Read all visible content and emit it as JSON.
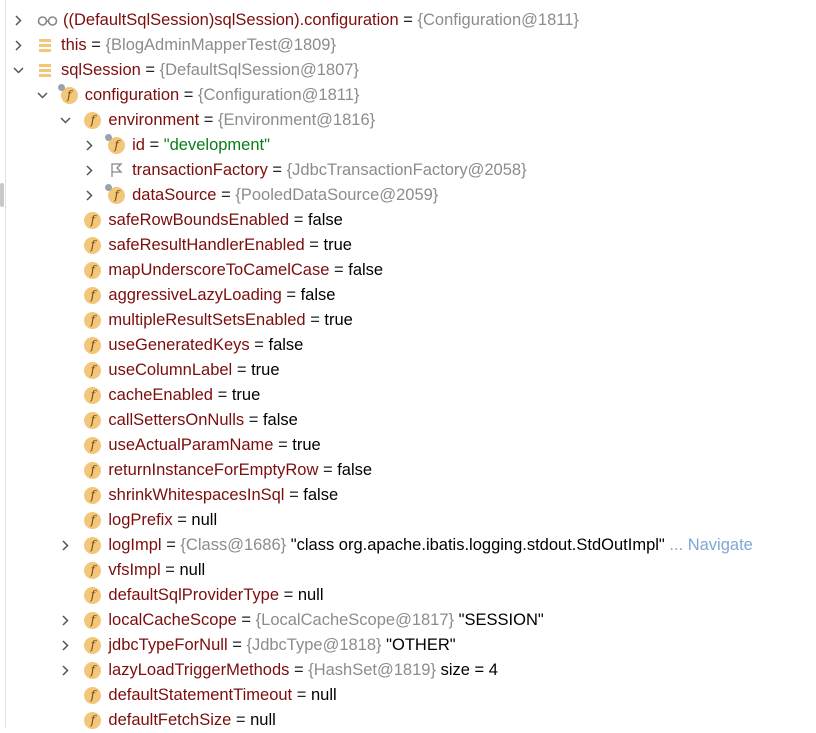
{
  "rows": [
    {
      "level": 0,
      "state": "collapsed",
      "icon": "watch-glasses-icon",
      "name": "((DefaultSqlSession)sqlSession).configuration",
      "type": "{Configuration@1811}"
    },
    {
      "level": 0,
      "state": "collapsed",
      "icon": "stack-frame-icon",
      "name": "this",
      "type": "{BlogAdminMapperTest@1809}"
    },
    {
      "level": 0,
      "state": "expanded",
      "icon": "stack-frame-icon",
      "name": "sqlSession",
      "type": "{DefaultSqlSession@1807}"
    },
    {
      "level": 1,
      "state": "expanded",
      "icon": "final-field-icon",
      "name": "configuration",
      "type": "{Configuration@1811}"
    },
    {
      "level": 2,
      "state": "expanded",
      "icon": "field-icon",
      "name": "environment",
      "type": "{Environment@1816}"
    },
    {
      "level": 3,
      "state": "collapsed",
      "icon": "final-field-icon",
      "name": "id",
      "string": "\"development\""
    },
    {
      "level": 3,
      "state": "collapsed",
      "icon": "flag-icon",
      "name": "transactionFactory",
      "type": "{JdbcTransactionFactory@2058}"
    },
    {
      "level": 3,
      "state": "collapsed",
      "icon": "final-field-icon",
      "name": "dataSource",
      "type": "{PooledDataSource@2059}"
    },
    {
      "level": 2,
      "state": "none",
      "icon": "field-icon",
      "name": "safeRowBoundsEnabled",
      "value": "false"
    },
    {
      "level": 2,
      "state": "none",
      "icon": "field-icon",
      "name": "safeResultHandlerEnabled",
      "value": "true"
    },
    {
      "level": 2,
      "state": "none",
      "icon": "field-icon",
      "name": "mapUnderscoreToCamelCase",
      "value": "false"
    },
    {
      "level": 2,
      "state": "none",
      "icon": "field-icon",
      "name": "aggressiveLazyLoading",
      "value": "false"
    },
    {
      "level": 2,
      "state": "none",
      "icon": "field-icon",
      "name": "multipleResultSetsEnabled",
      "value": "true"
    },
    {
      "level": 2,
      "state": "none",
      "icon": "field-icon",
      "name": "useGeneratedKeys",
      "value": "false"
    },
    {
      "level": 2,
      "state": "none",
      "icon": "field-icon",
      "name": "useColumnLabel",
      "value": "true"
    },
    {
      "level": 2,
      "state": "none",
      "icon": "field-icon",
      "name": "cacheEnabled",
      "value": "true"
    },
    {
      "level": 2,
      "state": "none",
      "icon": "field-icon",
      "name": "callSettersOnNulls",
      "value": "false"
    },
    {
      "level": 2,
      "state": "none",
      "icon": "field-icon",
      "name": "useActualParamName",
      "value": "true"
    },
    {
      "level": 2,
      "state": "none",
      "icon": "field-icon",
      "name": "returnInstanceForEmptyRow",
      "value": "false"
    },
    {
      "level": 2,
      "state": "none",
      "icon": "field-icon",
      "name": "shrinkWhitespacesInSql",
      "value": "false"
    },
    {
      "level": 2,
      "state": "none",
      "icon": "field-icon",
      "name": "logPrefix",
      "value": "null"
    },
    {
      "level": 2,
      "state": "collapsed",
      "icon": "field-icon",
      "name": "logImpl",
      "type": "{Class@1686}",
      "value": "\"class org.apache.ibatis.logging.stdout.StdOutImpl\"",
      "link": "... Navigate"
    },
    {
      "level": 2,
      "state": "none",
      "icon": "field-icon",
      "name": "vfsImpl",
      "value": "null"
    },
    {
      "level": 2,
      "state": "none",
      "icon": "field-icon",
      "name": "defaultSqlProviderType",
      "value": "null"
    },
    {
      "level": 2,
      "state": "collapsed",
      "icon": "field-icon",
      "name": "localCacheScope",
      "type": "{LocalCacheScope@1817}",
      "value": "\"SESSION\""
    },
    {
      "level": 2,
      "state": "collapsed",
      "icon": "field-icon",
      "name": "jdbcTypeForNull",
      "type": "{JdbcType@1818}",
      "value": "\"OTHER\""
    },
    {
      "level": 2,
      "state": "collapsed",
      "icon": "field-icon",
      "name": "lazyLoadTriggerMethods",
      "type": "{HashSet@1819}",
      "value": " size = 4"
    },
    {
      "level": 2,
      "state": "none",
      "icon": "field-icon",
      "name": "defaultStatementTimeout",
      "value": "null"
    },
    {
      "level": 2,
      "state": "none",
      "icon": "field-icon",
      "name": "defaultFetchSize",
      "value": "null"
    }
  ],
  "equals": "=",
  "colors": {
    "name": "#7b0d0d",
    "type": "#8c8c8c",
    "string": "#0a7d17",
    "link": "#7fa6d6",
    "field_icon": "#f4c67a"
  }
}
